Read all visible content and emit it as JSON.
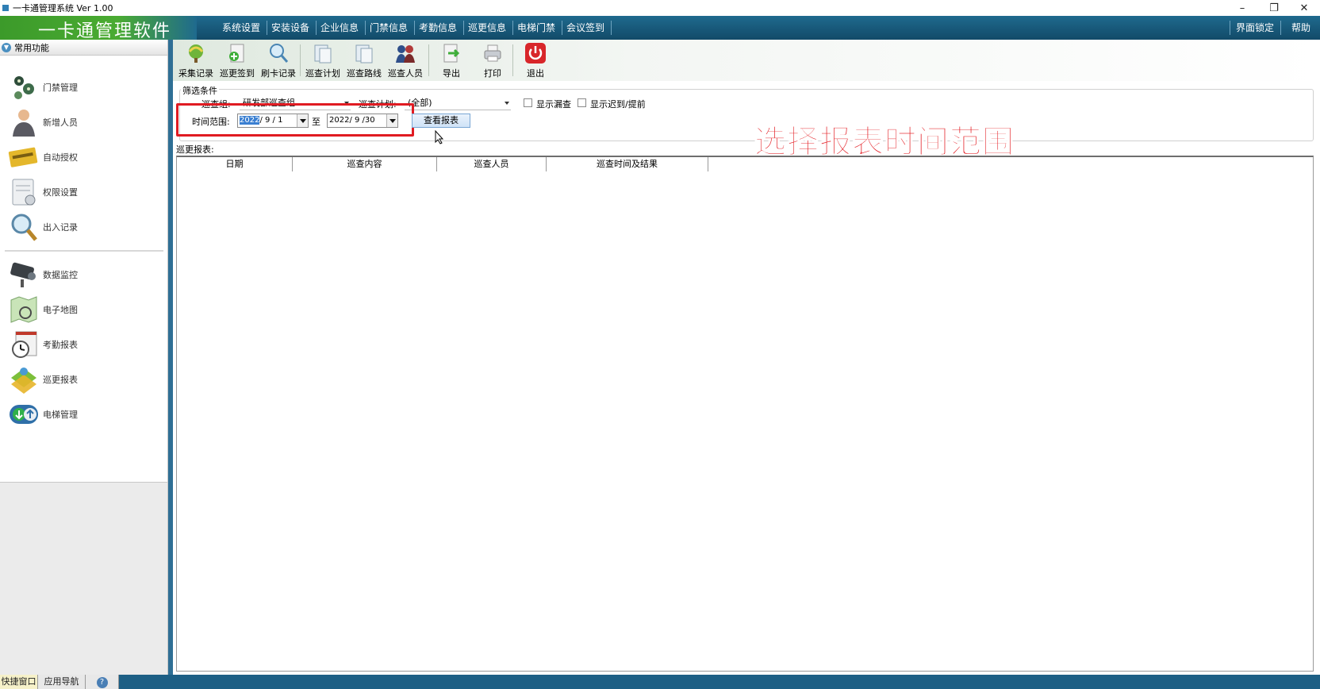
{
  "window": {
    "title": "一卡通管理系统  Ver 1.00",
    "minimize": "–",
    "restore": "❐",
    "close": "✕"
  },
  "menubar": {
    "brand": "一卡通管理软件",
    "items": [
      "系统设置",
      "安装设备",
      "企业信息",
      "门禁信息",
      "考勤信息",
      "巡更信息",
      "电梯门禁",
      "会议签到"
    ],
    "right_items": [
      "界面锁定",
      "帮助"
    ]
  },
  "left_panel": {
    "header": "常用功能",
    "items": [
      {
        "label": "门禁管理",
        "icon": "door-access-icon"
      },
      {
        "label": "新增人员",
        "icon": "person-icon"
      },
      {
        "label": "自动授权",
        "icon": "card-icon"
      },
      {
        "label": "权限设置",
        "icon": "permission-icon"
      },
      {
        "label": "出入记录",
        "icon": "search-record-icon"
      },
      {
        "label": "数据监控",
        "icon": "camera-icon"
      },
      {
        "label": "电子地图",
        "icon": "map-icon"
      },
      {
        "label": "考勤报表",
        "icon": "clock-icon"
      },
      {
        "label": "巡更报表",
        "icon": "patrol-icon"
      },
      {
        "label": "电梯管理",
        "icon": "elevator-icon"
      }
    ]
  },
  "bottom_tabs": [
    "快捷窗口",
    "应用导航",
    "?"
  ],
  "toolbar": {
    "buttons": [
      {
        "label": "采集记录",
        "icon": "collect-icon"
      },
      {
        "label": "巡更签到",
        "icon": "signin-icon"
      },
      {
        "label": "刷卡记录",
        "icon": "card-record-icon"
      },
      {
        "label": "巡查计划",
        "icon": "plan-icon"
      },
      {
        "label": "巡查路线",
        "icon": "route-icon"
      },
      {
        "label": "巡查人员",
        "icon": "people-icon"
      },
      {
        "label": "导出",
        "icon": "export-icon"
      },
      {
        "label": "打印",
        "icon": "print-icon"
      },
      {
        "label": "退出",
        "icon": "power-icon"
      }
    ]
  },
  "filter": {
    "legend": "筛选条件",
    "group_label": "巡查组:",
    "group_value": "研发部巡查组",
    "plan_label": "巡查计划:",
    "plan_value": "(全部)",
    "check_missed": "显示漏查",
    "check_late": "显示迟到/提前",
    "time_label": "时间范围:",
    "date_from_year": "2022",
    "date_from_rest": "/ 9 / 1",
    "to_label": "至",
    "date_to": "2022/ 9 /30",
    "view_button": "查看报表"
  },
  "annotation": "选择报表时间范围",
  "report": {
    "label": "巡更报表:",
    "columns": [
      "日期",
      "巡查内容",
      "巡查人员",
      "巡查时间及结果"
    ]
  },
  "colors": {
    "menubar": "#1a5b80",
    "brand_green": "#4aab32",
    "highlight_red": "#e01b22",
    "annotation_red": "#e31e24"
  }
}
